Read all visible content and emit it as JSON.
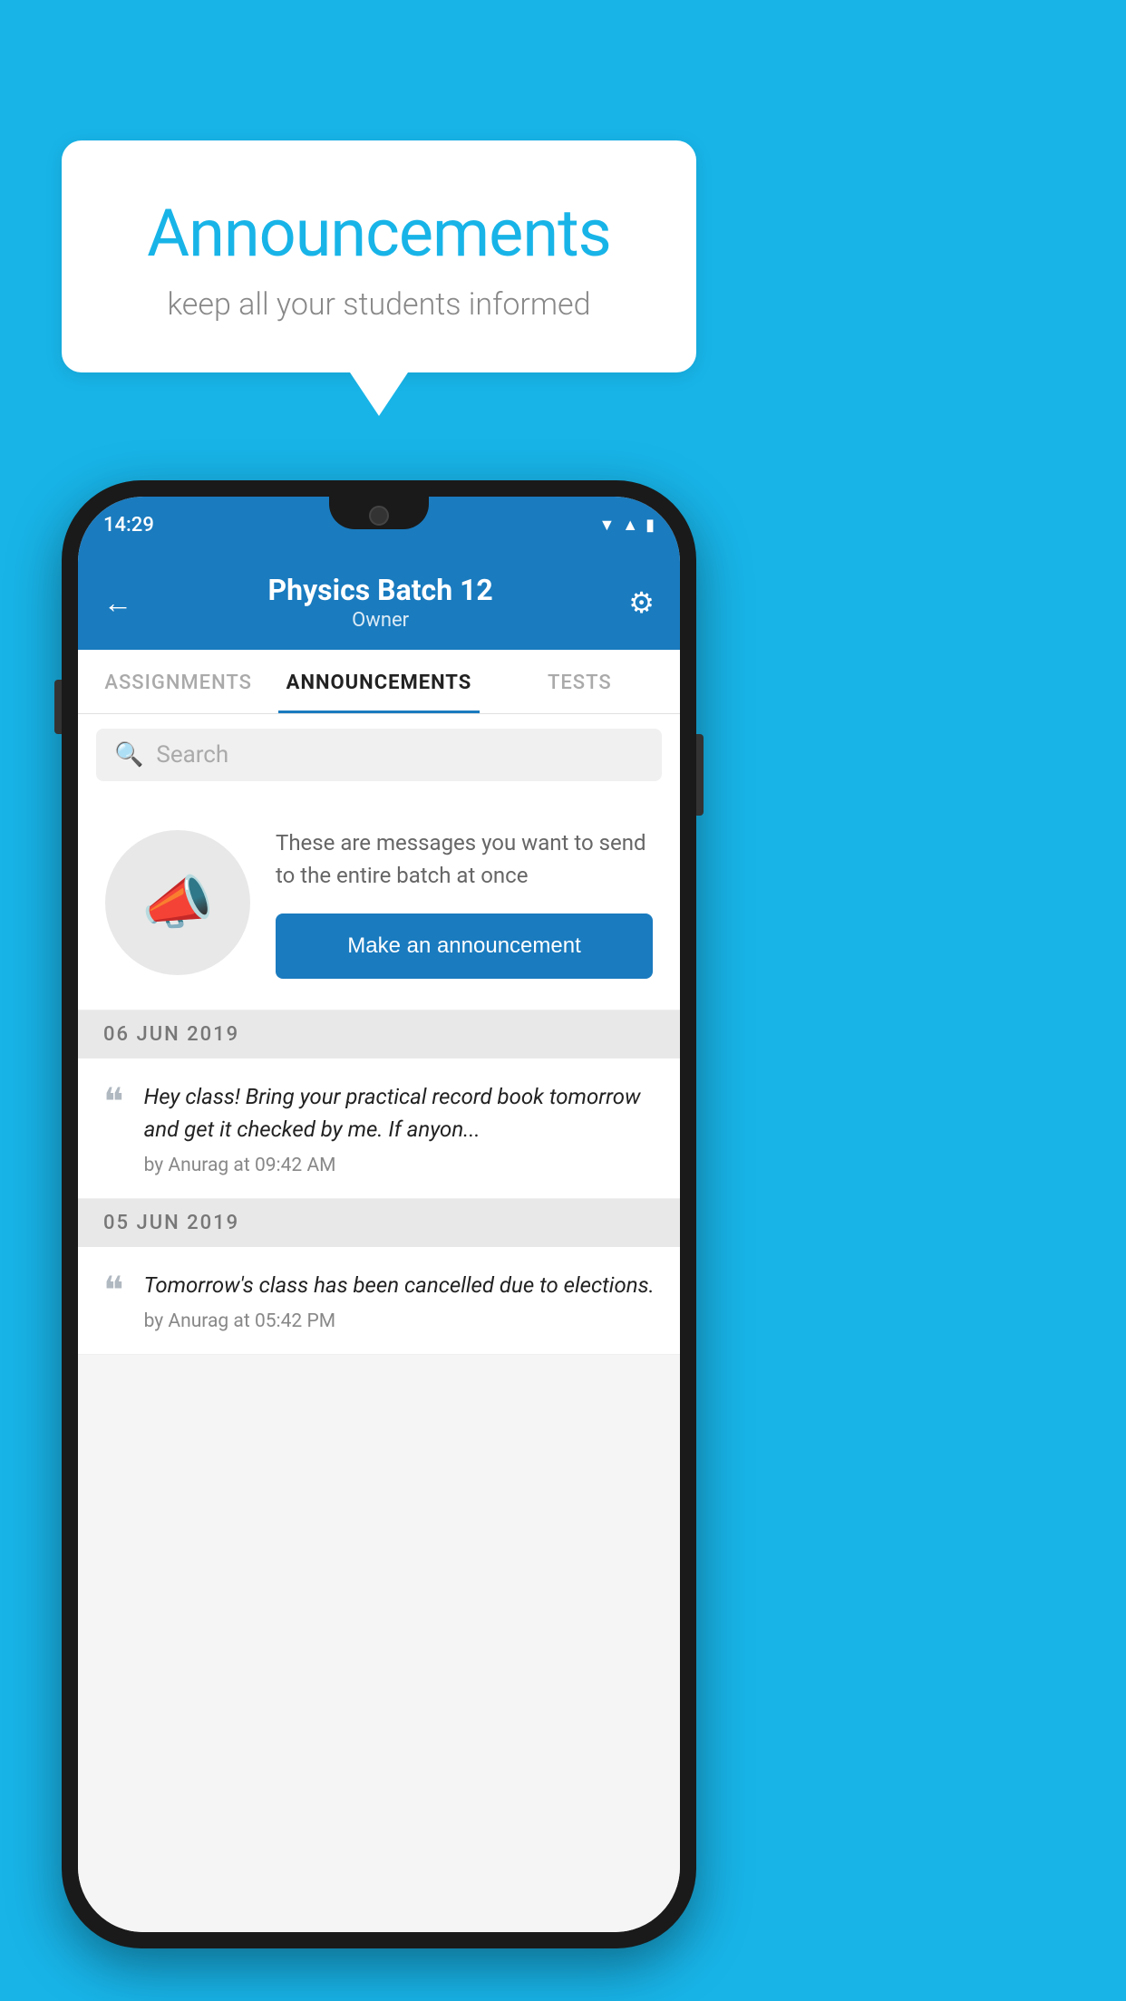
{
  "background_color": "#18b4e8",
  "speech_bubble": {
    "title": "Announcements",
    "subtitle": "keep all your students informed"
  },
  "phone": {
    "status_bar": {
      "time": "14:29"
    },
    "header": {
      "back_label": "←",
      "title": "Physics Batch 12",
      "subtitle": "Owner",
      "settings_label": "⚙"
    },
    "tabs": [
      {
        "label": "ASSIGNMENTS",
        "active": false
      },
      {
        "label": "ANNOUNCEMENTS",
        "active": true
      },
      {
        "label": "TESTS",
        "active": false
      }
    ],
    "search": {
      "placeholder": "Search"
    },
    "promo": {
      "description": "These are messages you want to send to the entire batch at once",
      "button_label": "Make an announcement"
    },
    "announcements": [
      {
        "date": "06  JUN  2019",
        "message": "Hey class! Bring your practical record book tomorrow and get it checked by me. If anyon...",
        "meta": "by Anurag at 09:42 AM"
      },
      {
        "date": "05  JUN  2019",
        "message": "Tomorrow's class has been cancelled due to elections.",
        "meta": "by Anurag at 05:42 PM"
      }
    ]
  }
}
